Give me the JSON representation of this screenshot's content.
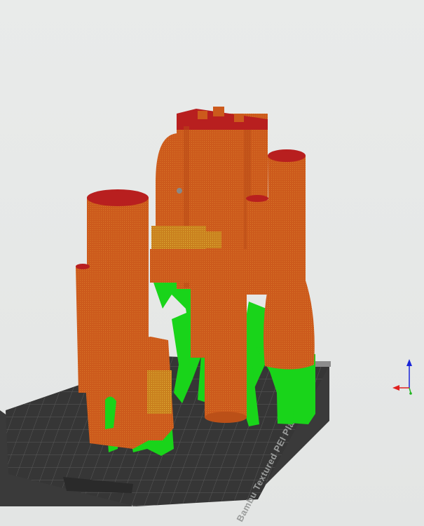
{
  "viewport": {
    "plate_label": "Bambu Textured PEI Plate"
  },
  "colors": {
    "background": "#e6e8e7",
    "plate": "#3a3a3a",
    "plate_grid": "#5a5a5a",
    "model": "#cc5a1c",
    "model_top": "#b81f1f",
    "support": "#19d41a",
    "axis_x": "#e0201e",
    "axis_y": "#21b521",
    "axis_z": "#1a26d8"
  },
  "icons": {
    "axis": "xyz-axis-icon"
  }
}
